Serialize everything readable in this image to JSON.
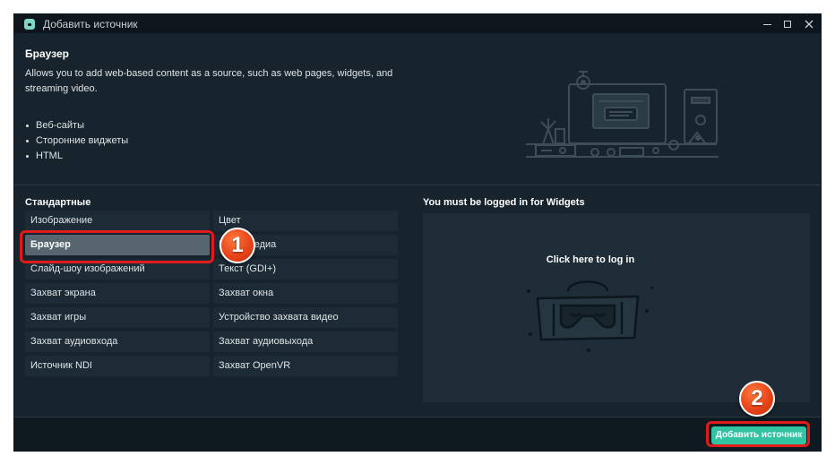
{
  "window": {
    "title": "Добавить источник"
  },
  "header": {
    "title": "Браузер",
    "description": "Allows you to add web-based content as a source, such as web pages, widgets, and streaming video.",
    "features": [
      "Веб-сайты",
      "Сторонние виджеты",
      "HTML"
    ]
  },
  "standard": {
    "title": "Стандартные",
    "items": [
      {
        "label": "Изображение",
        "selected": false
      },
      {
        "label": "Цвет",
        "selected": false
      },
      {
        "label": "Браузер",
        "selected": true
      },
      {
        "label": "Видеомедиа",
        "selected": false
      },
      {
        "label": "Слайд-шоу изображений",
        "selected": false
      },
      {
        "label": "Текст (GDI+)",
        "selected": false
      },
      {
        "label": "Захват экрана",
        "selected": false
      },
      {
        "label": "Захват окна",
        "selected": false
      },
      {
        "label": "Захват игры",
        "selected": false
      },
      {
        "label": "Устройство захвата видео",
        "selected": false
      },
      {
        "label": "Захват аудиовхода",
        "selected": false
      },
      {
        "label": "Захват аудиовыхода",
        "selected": false
      },
      {
        "label": "Источник NDI",
        "selected": false
      },
      {
        "label": "Захват OpenVR",
        "selected": false
      }
    ]
  },
  "widgets": {
    "title": "You must be logged in for Widgets",
    "login_text": "Click here to log in"
  },
  "footer": {
    "add_button": "Добавить источник"
  },
  "annotations": {
    "badge_1": "1",
    "badge_2": "2"
  },
  "colors": {
    "accent": "#31c3a2",
    "highlight": "#e01b1b",
    "badge": "#e8441a",
    "window_bg": "#17242d"
  }
}
